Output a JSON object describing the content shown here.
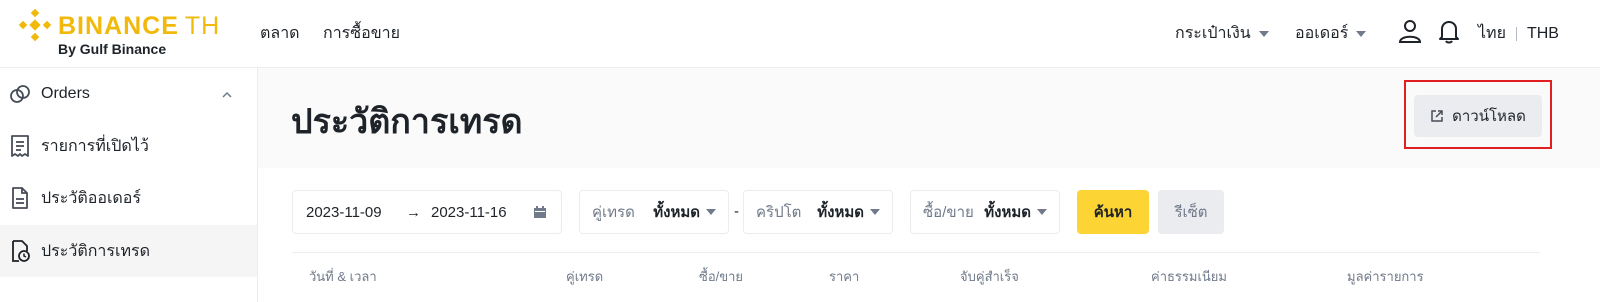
{
  "brand": {
    "name": "BINANCE",
    "region": "TH",
    "subtitle": "By Gulf Binance",
    "color": "#F0B90B"
  },
  "nav": {
    "items": [
      "ตลาด",
      "การซื้อขาย"
    ],
    "wallet": "กระเป๋าเงิน",
    "orders": "ออเดอร์",
    "lang": "ไทย",
    "currency": "THB",
    "icons": [
      "user-icon",
      "bell-icon"
    ]
  },
  "sidebar": {
    "items": [
      {
        "label": "Orders",
        "icon": "orders-icon"
      },
      {
        "label": "รายการที่เปิดไว้",
        "icon": "receipt-icon"
      },
      {
        "label": "ประวัติออเดอร์",
        "icon": "document-icon"
      },
      {
        "label": "ประวัติการเทรด",
        "icon": "trade-history-icon",
        "active": true
      }
    ]
  },
  "page": {
    "title": "ประวัติการเทรด",
    "download_label": "ดาวน์โหลด"
  },
  "filters": {
    "date_from": "2023-11-09",
    "date_arrow": "→",
    "date_to": "2023-11-16",
    "pair_label": "คู่เทรด",
    "pair_value": "ทั้งหมด",
    "dash": "-",
    "crypto_label": "คริปโต",
    "crypto_value": "ทั้งหมด",
    "side_label": "ซื้อ/ขาย",
    "side_value": "ทั้งหมด",
    "search_label": "ค้นหา",
    "reset_label": "รีเซ็ต"
  },
  "table": {
    "headers": [
      "วันที่ & เวลา",
      "คู่เทรด",
      "ซื้อ/ขาย",
      "ราคา",
      "จับคู่สำเร็จ",
      "ค่าธรรมเนียม",
      "มูลค่ารายการ"
    ]
  },
  "colors": {
    "accent": "#FCD535",
    "highlight_border": "#e02020"
  }
}
